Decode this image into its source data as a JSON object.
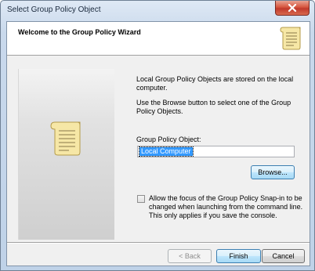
{
  "window": {
    "title": "Select Group Policy Object"
  },
  "header": {
    "title": "Welcome to the Group Policy Wizard",
    "icon": "scroll-icon"
  },
  "main": {
    "intro_line1": "Local Group Policy Objects are stored on the local computer.",
    "intro_line2": "Use the Browse button to select one of the Group Policy Objects.",
    "gpo_label": "Group Policy Object:",
    "gpo_value": "Local Computer",
    "browse_label": "Browse...",
    "checkbox_label": "Allow the focus of the Group Policy Snap-in to be changed when launching from the command line.  This only applies if you save the console.",
    "checkbox_checked": false
  },
  "footer": {
    "back_label": "< Back",
    "finish_label": "Finish",
    "cancel_label": "Cancel"
  },
  "colors": {
    "accent_blue": "#3399ff",
    "close_red": "#c0392b",
    "scroll_parchment": "#f6e7a6"
  }
}
